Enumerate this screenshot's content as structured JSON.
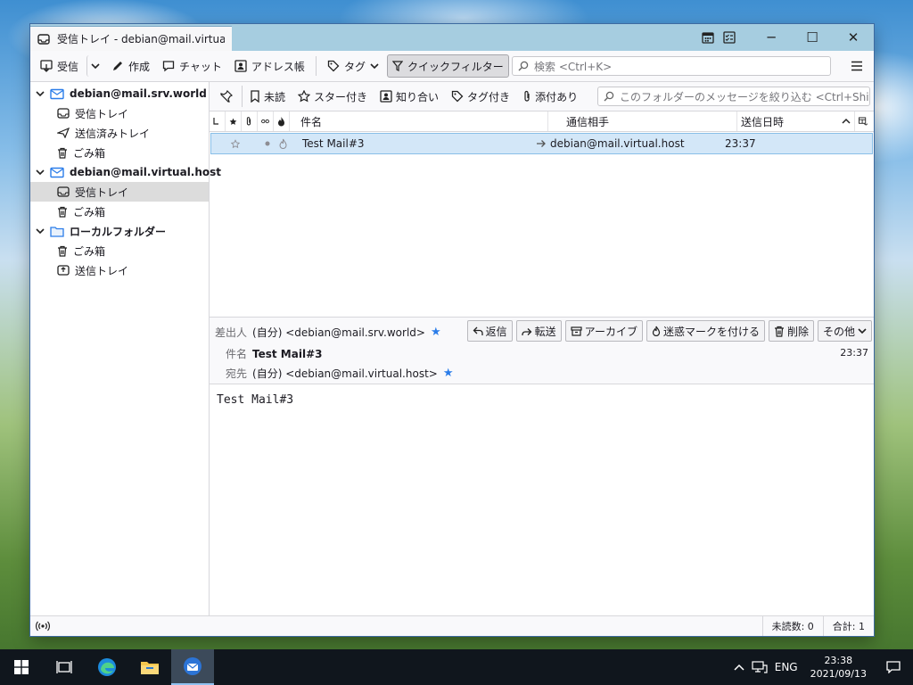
{
  "window": {
    "tab_title": "受信トレイ - debian@mail.virtual.host",
    "tab_title_visible": "受信トレイ - debian@mail.virtual"
  },
  "toolbar": {
    "get_messages": "受信",
    "write": "作成",
    "chat": "チャット",
    "address_book": "アドレス帳",
    "tag": "タグ",
    "quick_filter": "クイックフィルター",
    "search_placeholder": "検索 <Ctrl+K>"
  },
  "folders": {
    "accounts": [
      {
        "name": "debian@mail.srv.world",
        "folders": [
          "受信トレイ",
          "送信済みトレイ",
          "ごみ箱"
        ]
      },
      {
        "name": "debian@mail.virtual.host",
        "folders": [
          "受信トレイ",
          "ごみ箱"
        ]
      },
      {
        "name": "ローカルフォルダー",
        "folders": [
          "ごみ箱",
          "送信トレイ"
        ]
      }
    ]
  },
  "filterbar": {
    "unread": "未読",
    "starred": "スター付き",
    "contacts": "知り合い",
    "tagged": "タグ付き",
    "attachment": "添付あり",
    "search_placeholder": "このフォルダーのメッセージを絞り込む <Ctrl+Shift+K>"
  },
  "thread_columns": {
    "subject": "件名",
    "correspondent": "通信相手",
    "date": "送信日時"
  },
  "messages": [
    {
      "subject": "Test Mail#3",
      "correspondent": "debian@mail.virtual.host",
      "date": "23:37"
    }
  ],
  "message_header": {
    "from_label": "差出人",
    "from_value": "(自分) <debian@mail.srv.world>",
    "subject_label": "件名",
    "subject_value": "Test Mail#3",
    "to_label": "宛先",
    "to_value": "(自分) <debian@mail.virtual.host>",
    "time": "23:37",
    "buttons": {
      "reply": "返信",
      "forward": "転送",
      "archive": "アーカイブ",
      "junk": "迷惑マークを付ける",
      "delete": "削除",
      "other": "その他"
    }
  },
  "message_body": "Test Mail#3",
  "status": {
    "unread": "未読数: 0",
    "total": "合計: 1"
  },
  "taskbar": {
    "lang": "ENG",
    "time": "23:38",
    "date": "2021/09/13"
  }
}
